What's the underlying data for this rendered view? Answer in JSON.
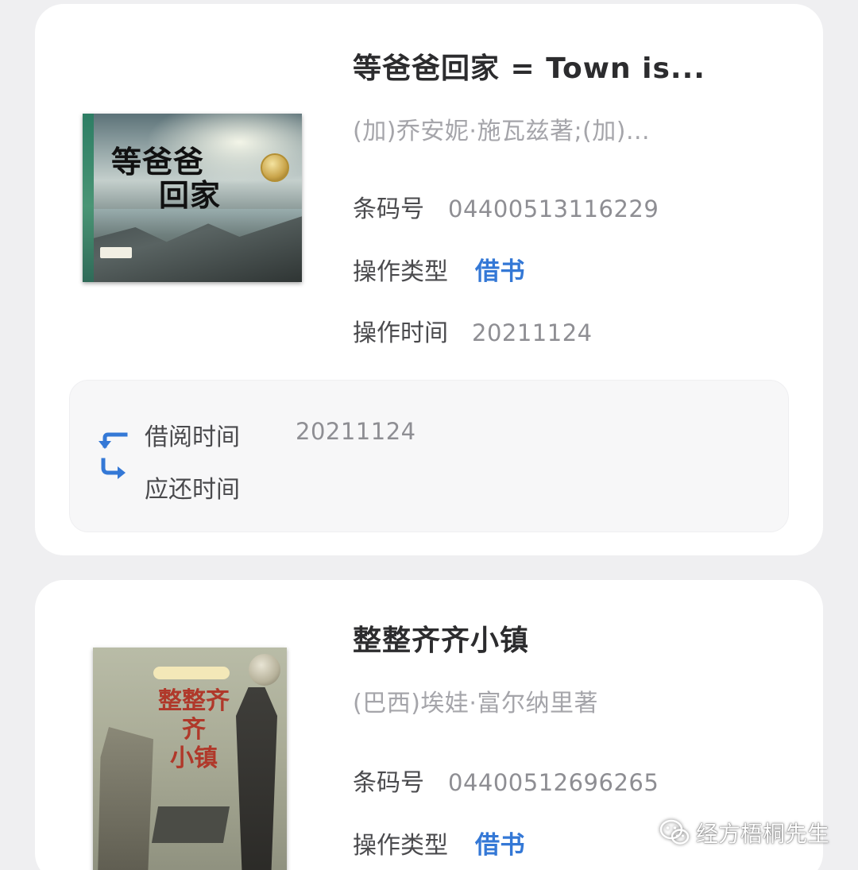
{
  "records": [
    {
      "title": "等爸爸回家 = Town is...",
      "author": "(加)乔安妮·施瓦兹著;(加)...",
      "barcode_label": "条码号",
      "barcode": "04400513116229",
      "op_type_label": "操作类型",
      "op_type": "借书",
      "op_time_label": "操作时间",
      "op_time": "20211124",
      "cover_title_line1": "等爸爸",
      "cover_title_line2": "回家",
      "loan": {
        "borrow_label": "借阅时间",
        "borrow_value": "20211124",
        "due_label": "应还时间",
        "due_value": ""
      }
    },
    {
      "title": "整整齐齐小镇",
      "author": "(巴西)埃娃·富尔纳里著",
      "barcode_label": "条码号",
      "barcode": "04400512696265",
      "op_type_label": "操作类型",
      "op_type": "借书",
      "cover_title_line1": "整整齐齐",
      "cover_title_line2": "小镇"
    }
  ],
  "watermark": "经方梧桐先生",
  "colors": {
    "accent": "#3478d6",
    "card": "#ffffff",
    "background": "#efeff1",
    "loan_box": "#f7f7f8"
  },
  "icons": [
    "swap-arrows-icon",
    "wechat-icon"
  ]
}
